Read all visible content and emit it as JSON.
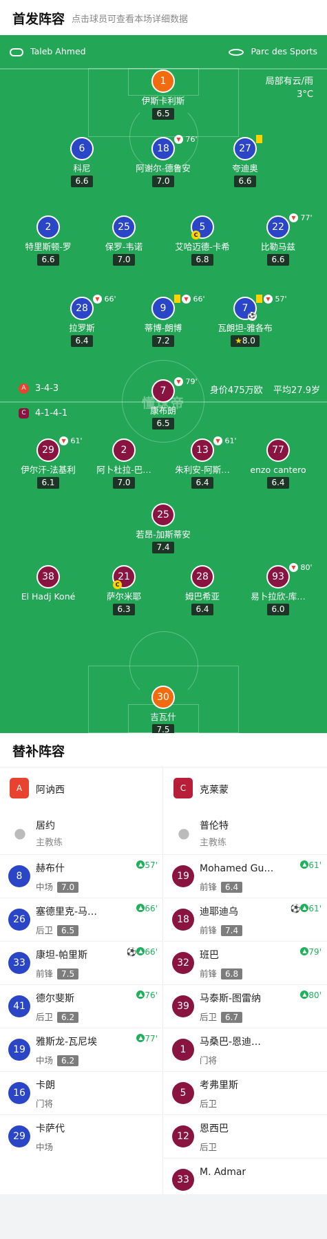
{
  "header": {
    "title": "首发阵容",
    "subtitle": "点击球员可查看本场详细数据"
  },
  "pitch": {
    "referee": "Taleb Ahmed",
    "stadium": "Parc des Sports",
    "weather": "局部有云/雨",
    "temperature": "3°C",
    "home_formation": "3-4-3",
    "away_formation": "4-1-4-1",
    "market_value": "身价475万欧",
    "avg_age": "平均27.9岁",
    "watermark": "懂球帝"
  },
  "home": [
    {
      "num": "1",
      "name": "伊斯卡利斯",
      "rating": "6.5",
      "gk": true
    },
    {
      "num": "6",
      "name": "科尼",
      "rating": "6.6"
    },
    {
      "num": "18",
      "name": "阿谢尔-德鲁安",
      "rating": "7.0",
      "sub": "76'"
    },
    {
      "num": "27",
      "name": "夸迪奥",
      "rating": "6.6",
      "yellow": true
    },
    {
      "num": "2",
      "name": "特里斯顿-罗",
      "rating": "6.6"
    },
    {
      "num": "25",
      "name": "保罗-韦诺",
      "rating": "7.0"
    },
    {
      "num": "5",
      "name": "艾哈迈德-卡希",
      "rating": "6.8",
      "captain": "C"
    },
    {
      "num": "22",
      "name": "比勒马兹",
      "rating": "6.6",
      "sub": "77'"
    },
    {
      "num": "28",
      "name": "拉罗斯",
      "rating": "6.4",
      "sub": "66'"
    },
    {
      "num": "9",
      "name": "蒂博-朗博",
      "rating": "7.2",
      "sub": "66'",
      "yellow": true
    },
    {
      "num": "7",
      "name": "瓦朗坦-雅各布",
      "rating": "8.0",
      "sub": "57'",
      "yellow": true,
      "goal": true,
      "best": true
    }
  ],
  "away": [
    {
      "num": "7",
      "name": "康布朗",
      "rating": "6.5",
      "sub": "79'"
    },
    {
      "num": "29",
      "name": "伊尔汗-法基利",
      "rating": "6.1",
      "sub": "61'"
    },
    {
      "num": "2",
      "name": "阿卜杜拉-巴…",
      "rating": "7.0"
    },
    {
      "num": "13",
      "name": "朱利安-阿斯…",
      "rating": "6.4",
      "sub": "61'"
    },
    {
      "num": "77",
      "name": "enzo cantero",
      "rating": "6.4"
    },
    {
      "num": "25",
      "name": "若昂-加斯蒂安",
      "rating": "7.4"
    },
    {
      "num": "38",
      "name": "El Hadj Koné",
      "rating": ""
    },
    {
      "num": "21",
      "name": "萨尔米耶",
      "rating": "6.3",
      "captain": "C"
    },
    {
      "num": "28",
      "name": "姆巴希亚",
      "rating": "6.4"
    },
    {
      "num": "93",
      "name": "易卜拉欣-库…",
      "rating": "6.0",
      "sub": "80'"
    },
    {
      "num": "30",
      "name": "吉瓦什",
      "rating": "7.5",
      "gk": true
    }
  ],
  "bench": {
    "title": "替补阵容",
    "home": {
      "team": "阿讷西",
      "logo_color": "#e8432e",
      "coach": "居约",
      "coach_role": "主教练",
      "players": [
        {
          "num": "8",
          "name": "赫布什",
          "pos": "中场",
          "rating": "7.0",
          "in": "57'"
        },
        {
          "num": "26",
          "name": "塞德里克-马…",
          "pos": "后卫",
          "rating": "6.5",
          "in": "66'"
        },
        {
          "num": "33",
          "name": "康坦-帕里斯",
          "pos": "前锋",
          "rating": "7.5",
          "in": "66'",
          "goal": true
        },
        {
          "num": "41",
          "name": "德尔斐斯",
          "pos": "后卫",
          "rating": "6.2",
          "in": "76'"
        },
        {
          "num": "19",
          "name": "雅斯龙-瓦尼埃",
          "pos": "中场",
          "rating": "6.2",
          "in": "77'"
        },
        {
          "num": "16",
          "name": "卡朗",
          "pos": "门将",
          "rating": ""
        },
        {
          "num": "29",
          "name": "卡萨代",
          "pos": "中场",
          "rating": ""
        }
      ]
    },
    "away": {
      "team": "克莱蒙",
      "logo_color": "#b81e3a",
      "coach": "普伦特",
      "coach_role": "主教练",
      "players": [
        {
          "num": "19",
          "name": "Mohamed Gu…",
          "pos": "前锋",
          "rating": "6.4",
          "in": "61'"
        },
        {
          "num": "18",
          "name": "迪耶迪乌",
          "pos": "前锋",
          "rating": "7.4",
          "in": "61'",
          "goal": true
        },
        {
          "num": "32",
          "name": "班巴",
          "pos": "前锋",
          "rating": "6.8",
          "in": "79'"
        },
        {
          "num": "39",
          "name": "马泰斯-图雷纳",
          "pos": "后卫",
          "rating": "6.7",
          "in": "80'"
        },
        {
          "num": "1",
          "name": "马桑巴-恩迪…",
          "pos": "门将",
          "rating": ""
        },
        {
          "num": "5",
          "name": "考弗里斯",
          "pos": "后卫",
          "rating": ""
        },
        {
          "num": "12",
          "name": "恩西巴",
          "pos": "后卫",
          "rating": ""
        },
        {
          "num": "33",
          "name": "M. Admar",
          "pos": "",
          "rating": ""
        }
      ]
    }
  },
  "colors": {
    "pitch": "#23a757",
    "home": "#2a45c6",
    "away": "#8a1440",
    "gk": "#f36b0f"
  }
}
